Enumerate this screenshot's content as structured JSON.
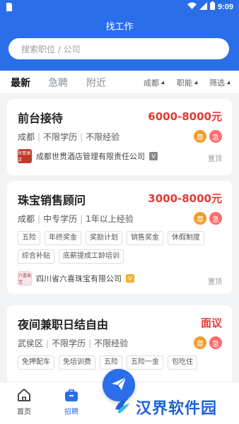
{
  "status_bar": {
    "time": "9:09"
  },
  "header": {
    "title": "找工作"
  },
  "search": {
    "placeholder": "搜索职位 / 公司"
  },
  "filters": {
    "tabs": [
      "最新",
      "急聘",
      "附近"
    ],
    "active_tab": "最新",
    "dropdowns": [
      "成都",
      "职能",
      "筛选"
    ]
  },
  "badges": {
    "zun": "尊",
    "ji": "急"
  },
  "jobs": [
    {
      "title": "前台接待",
      "salary": "6000-8000元",
      "meta": [
        "成都",
        "不限学历",
        "不限经验"
      ],
      "tags": [],
      "company": "成都世贯酒店管理有限责任公司",
      "logo_text": "世贯酒店",
      "logo_color": "#c0392b",
      "verify_text": "V",
      "verify_color": "#8a8a8a",
      "pin": "置顶"
    },
    {
      "title": "珠宝销售顾问",
      "salary": "3000-8000元",
      "meta": [
        "成都",
        "中专学历",
        "1年以上经验"
      ],
      "tags": [
        "五险",
        "年终奖金",
        "奖励计划",
        "销售奖金",
        "休假制度",
        "综合补贴",
        "底薪提成工龄培训"
      ],
      "company": "四川省六喜珠宝有限公司",
      "logo_text": "六喜珠宝",
      "logo_color": "#f5e6ea",
      "verify_text": "V",
      "verify_color": "#f2b233",
      "pin": "置顶"
    },
    {
      "title": "夜间兼职日结自由",
      "salary": "面议",
      "meta": [
        "武侯区",
        "不限学历",
        "不限经验"
      ],
      "tags": [
        "免押配车",
        "免培训费",
        "五险",
        "五险一金",
        "包吃住"
      ]
    }
  ],
  "tabbar": [
    {
      "label": "首页",
      "icon": "home-icon"
    },
    {
      "label": "招聘",
      "icon": "briefcase-icon"
    }
  ],
  "watermark": {
    "text": "汉界软件园"
  },
  "colors": {
    "primary": "#2a6ee9",
    "salary": "#e53935",
    "zun": "#f39c2b",
    "ji": "#ff6b6b"
  }
}
